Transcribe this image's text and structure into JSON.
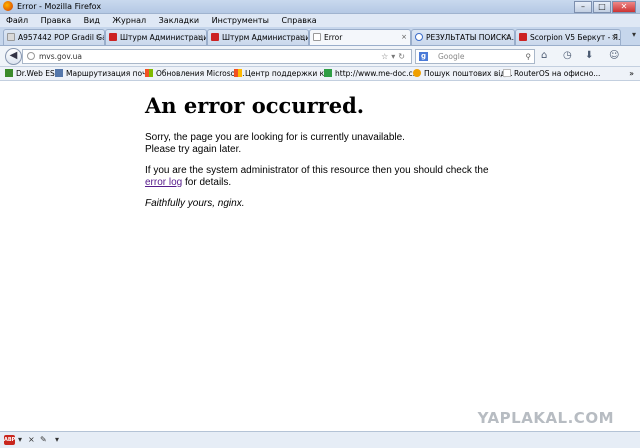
{
  "window": {
    "title": "Error - Mozilla Firefox",
    "controls": [
      "–",
      "□",
      "✕"
    ]
  },
  "menu": [
    "Файл",
    "Правка",
    "Вид",
    "Журнал",
    "Закладки",
    "Инструменты",
    "Справка"
  ],
  "tabs": [
    {
      "label": "A957442 POP Gradil Ga...",
      "favicon_color": "#d9d9d9",
      "close": "×"
    },
    {
      "label": "Штурм Администраци...",
      "favicon_color": "#cc2222",
      "close": "×"
    },
    {
      "label": "Штурм Администраци...",
      "favicon_color": "#cc2222",
      "close": "×"
    },
    {
      "label": "Error",
      "favicon_color": "#ffffff",
      "close": "×",
      "active": true
    },
    {
      "label": "РЕЗУЛЬТАТЫ ПОИСКА...",
      "favicon_color": "#3b6cc9",
      "close": "×"
    },
    {
      "label": "Scorpion V5 Беркут - Я...",
      "favicon_color": "#cc2222",
      "close": "×"
    }
  ],
  "tab_scroll": "▾",
  "navigation": {
    "back_glyph": "◀",
    "url": "mvs.gov.ua",
    "url_buttons": "☆▾↻",
    "search_engine": "g",
    "search_placeholder": "Google",
    "search_glyph": "⚲",
    "home_glyph": "⌂",
    "history_glyph": "◷",
    "download_glyph": "⬇",
    "addon_glyph": "☺"
  },
  "bookmarks": [
    {
      "label": "Dr.Web ES",
      "icon_color": "#3b8a2a"
    },
    {
      "label": "Маршрутизация поч...",
      "icon_color": "#5577aa"
    },
    {
      "label": "Обновления Microsof...",
      "icon_color": "#f25022"
    },
    {
      "label": "Центр поддержки к...",
      "icon_color": "#f25022"
    },
    {
      "label": "http://www.me-doc.c...",
      "icon_color": "#2f9e44"
    },
    {
      "label": "Пошук поштових від...",
      "icon_color": "#f0a000"
    },
    {
      "label": "RouterOS на офисно...",
      "icon_color": "#bbbbbb"
    }
  ],
  "bookmarks_more": "»",
  "page": {
    "heading": "An error occurred.",
    "para1_line1": "Sorry, the page you are looking for is currently unavailable.",
    "para1_line2": "Please try again later.",
    "para2_line1": "If you are the system administrator of this resource then you should check the",
    "para2_link": "error log",
    "para2_tail": " for details.",
    "signature": "Faithfully yours, nginx."
  },
  "watermark": "YAPLAKAL.COM",
  "status": {
    "abp": "ABP",
    "dropdown": "▾",
    "close": "×",
    "tool": "✎",
    "tool_dropdown": "▾"
  }
}
